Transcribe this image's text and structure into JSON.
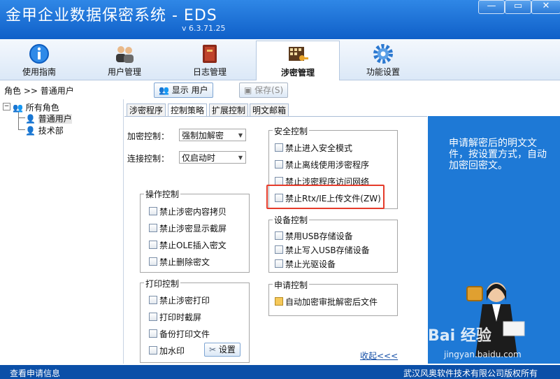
{
  "window": {
    "title": "金甲企业数据保密系统 - EDS",
    "version": "v 6.3.71.25",
    "minimize_label": "—",
    "restore_label": "▭",
    "close_label": "✕"
  },
  "nav": [
    {
      "label": "使用指南",
      "icon": "info-icon"
    },
    {
      "label": "用户管理",
      "icon": "users-icon"
    },
    {
      "label": "日志管理",
      "icon": "book-icon"
    },
    {
      "label": "涉密管理",
      "icon": "secret-key-icon",
      "active": true
    },
    {
      "label": "功能设置",
      "icon": "gear-icon"
    }
  ],
  "breadcrumb": "角色 >> 普通用户",
  "toolbar": {
    "show_user": "显示 用户",
    "save": "保存(S)"
  },
  "tree": {
    "root": "所有角色",
    "children": [
      "普通用户",
      "技术部"
    ]
  },
  "subtabs": [
    "涉密程序",
    "控制策略",
    "扩展控制",
    "明文邮箱"
  ],
  "fields": {
    "encrypt_label": "加密控制：",
    "encrypt_value": "强制加解密",
    "connect_label": "连接控制：",
    "connect_value": "仅启动时"
  },
  "groups": {
    "operation": {
      "title": "操作控制",
      "items": [
        "禁止涉密内容拷贝",
        "禁止涉密显示截屏",
        "禁止OLE插入密文",
        "禁止删除密文"
      ]
    },
    "print": {
      "title": "打印控制",
      "items": [
        "禁止涉密打印",
        "打印时截屏",
        "备份打印文件",
        "加水印"
      ],
      "settings_button": "设置"
    },
    "security": {
      "title": "安全控制",
      "items": [
        "禁止进入安全模式",
        "禁止离线使用涉密程序",
        "禁止涉密程序访问网络",
        "禁止Rtx/IE上传文件(ZW)"
      ]
    },
    "device": {
      "title": "设备控制",
      "items": [
        "禁用USB存储设备",
        "禁止写入USB存储设备",
        "禁止光驱设备"
      ]
    },
    "apply": {
      "title": "申请控制",
      "items": [
        "自动加密审批解密后文件"
      ]
    }
  },
  "fold_link": "收起<<<",
  "info_text": "申请解密后的明文文件，按设置方式，自动加密回密文。",
  "status": {
    "left": "查看申请信息",
    "right": "武汉风奥软件技术有限公司版权所有"
  },
  "watermark": {
    "logo": "Bai 经验",
    "url": "jingyan.baidu.com"
  },
  "colors": {
    "titlebar": "#1a6fd8",
    "info_panel": "#1e79d6",
    "highlight": "#e53b2a",
    "statusbar": "#0b4fa8"
  }
}
